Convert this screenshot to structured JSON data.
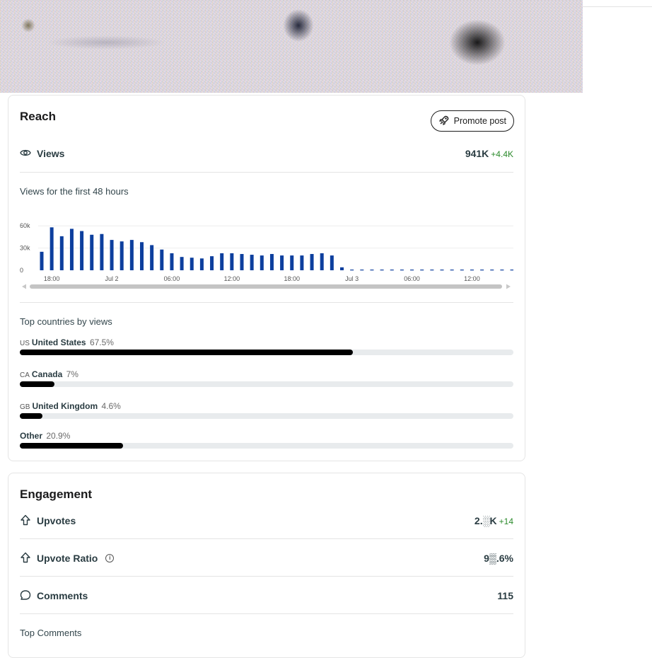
{
  "reach": {
    "title": "Reach",
    "promote_label": "Promote post",
    "views_label": "Views",
    "views_value": "941K",
    "views_delta": "+4.4K",
    "chart_subtitle": "Views for the first 48 hours",
    "countries_title": "Top countries by views",
    "countries": [
      {
        "code": "US",
        "name": "United States",
        "pct_label": "67.5%",
        "fraction": 0.675
      },
      {
        "code": "CA",
        "name": "Canada",
        "pct_label": "7%",
        "fraction": 0.07
      },
      {
        "code": "GB",
        "name": "United Kingdom",
        "pct_label": "4.6%",
        "fraction": 0.046
      },
      {
        "code": "",
        "name": "Other",
        "pct_label": "20.9%",
        "fraction": 0.209
      }
    ]
  },
  "engagement": {
    "title": "Engagement",
    "upvotes_label": "Upvotes",
    "upvotes_value": "2.░K",
    "upvotes_delta": "+14",
    "ratio_label": "Upvote Ratio",
    "ratio_value": "9▒.6%",
    "comments_label": "Comments",
    "comments_value": "115",
    "top_comments_label": "Top Comments"
  },
  "colors": {
    "bar": "#0d3f9e",
    "delta": "#2b8a2b",
    "fill": "#000000",
    "track": "#e8ebed"
  },
  "icons": {
    "views": "eye-icon",
    "promote": "rocket-icon",
    "upvotes": "upvote-arrow-icon",
    "comments": "comment-bubble-icon",
    "info": "info-icon"
  },
  "chart_data": {
    "type": "bar",
    "y_tick_labels": [
      "0",
      "30k",
      "60k"
    ],
    "ylim": [
      0,
      65000
    ],
    "x_tick_labels": [
      "18:00",
      "Jul 2",
      "06:00",
      "12:00",
      "18:00",
      "Jul 3",
      "06:00",
      "12:00"
    ],
    "x_tick_bar_index": [
      1,
      7,
      13,
      19,
      25,
      31,
      37,
      43
    ],
    "values": [
      25000,
      58000,
      46000,
      56000,
      53000,
      48000,
      49000,
      41000,
      39000,
      41000,
      38000,
      34000,
      28000,
      23000,
      18000,
      17000,
      16000,
      19000,
      23000,
      23000,
      22000,
      21000,
      20000,
      22000,
      20000,
      20000,
      20000,
      22000,
      23000,
      20000,
      4000,
      0,
      0,
      0,
      0,
      0,
      0,
      0,
      0,
      0,
      0,
      0,
      0,
      0,
      0,
      0,
      0,
      0
    ]
  }
}
